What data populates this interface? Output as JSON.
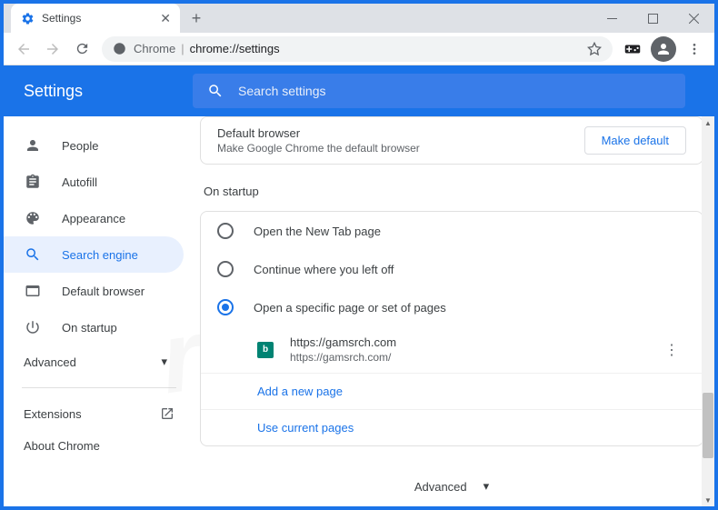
{
  "tab": {
    "title": "Settings"
  },
  "address": {
    "prefix": "Chrome",
    "url": "chrome://settings"
  },
  "header": {
    "title": "Settings"
  },
  "search": {
    "placeholder": "Search settings"
  },
  "sidebar": {
    "items": [
      {
        "label": "People"
      },
      {
        "label": "Autofill"
      },
      {
        "label": "Appearance"
      },
      {
        "label": "Search engine"
      },
      {
        "label": "Default browser"
      },
      {
        "label": "On startup"
      }
    ],
    "advanced": "Advanced",
    "extensions": "Extensions",
    "about": "About Chrome"
  },
  "default_browser": {
    "title": "Default browser",
    "subtitle": "Make Google Chrome the default browser",
    "button": "Make default"
  },
  "startup": {
    "title": "On startup",
    "options": [
      "Open the New Tab page",
      "Continue where you left off",
      "Open a specific page or set of pages"
    ],
    "page": {
      "title": "https://gamsrch.com",
      "url": "https://gamsrch.com/",
      "favicon_letter": "b"
    },
    "add_page": "Add a new page",
    "use_current": "Use current pages"
  },
  "footer_advanced": "Advanced",
  "watermark": "pcrisk.com"
}
